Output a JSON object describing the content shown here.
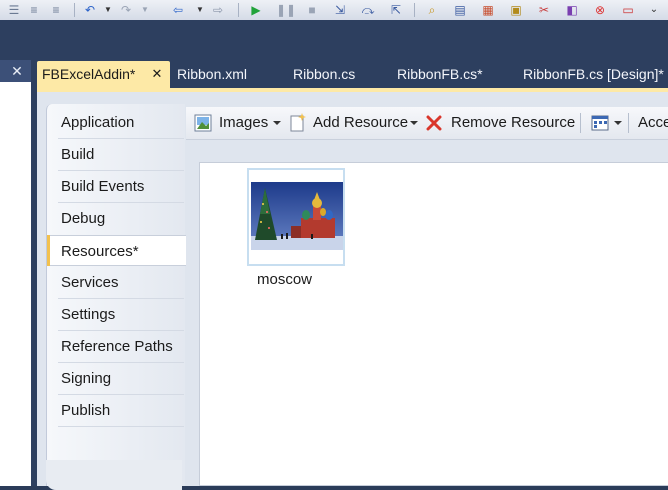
{
  "document_tabs": [
    {
      "label": "FBExcelAddin*",
      "active": true
    },
    {
      "label": "Ribbon.xml",
      "active": false
    },
    {
      "label": "Ribbon.cs",
      "active": false
    },
    {
      "label": "RibbonFB.cs*",
      "active": false
    },
    {
      "label": "RibbonFB.cs [Design]*",
      "active": false
    }
  ],
  "left_panel": {
    "close_glyph": "✕"
  },
  "active_tab_close_glyph": "✕",
  "property_tabs": [
    {
      "label": "Application",
      "selected": false
    },
    {
      "label": "Build",
      "selected": false
    },
    {
      "label": "Build Events",
      "selected": false
    },
    {
      "label": "Debug",
      "selected": false
    },
    {
      "label": "Resources*",
      "selected": true
    },
    {
      "label": "Services",
      "selected": false
    },
    {
      "label": "Settings",
      "selected": false
    },
    {
      "label": "Reference Paths",
      "selected": false
    },
    {
      "label": "Signing",
      "selected": false
    },
    {
      "label": "Publish",
      "selected": false
    }
  ],
  "resource_toolbar": {
    "images_label": "Images",
    "add_resource_label": "Add Resource",
    "remove_resource_label": "Remove Resource",
    "access_label": "Acce"
  },
  "resources": [
    {
      "name": "moscow",
      "icon": "image-thumbnail"
    }
  ],
  "colors": {
    "active_tab": "#fde9a6",
    "chrome": "#2d3f5f",
    "selected_marker": "#f2c14e"
  }
}
